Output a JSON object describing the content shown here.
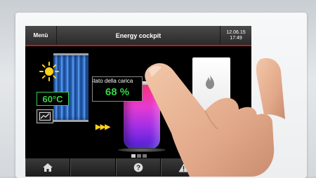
{
  "header": {
    "menu_label": "Menù",
    "title": "Energy cockpit",
    "date": "12.06.15",
    "time": "17:49"
  },
  "solar": {
    "temperature": "60°C"
  },
  "storage": {
    "charge_label": "Stato della carica",
    "charge_value": "68 %"
  },
  "icons": {
    "sun": "sun-icon",
    "graph": "chart-icon",
    "flame": "flame-icon",
    "home": "home-icon",
    "help": "question-icon",
    "warning": "warning-icon"
  },
  "page_indicator": {
    "pages": 3,
    "active": 1
  },
  "colors": {
    "accent_red": "#c8181c",
    "value_green": "#3ad14a",
    "arrow_yellow": "#ffd21a",
    "arrow_red": "#ff3340"
  },
  "footer": {
    "buttons": [
      "home",
      "",
      "help",
      "warning",
      ""
    ]
  }
}
